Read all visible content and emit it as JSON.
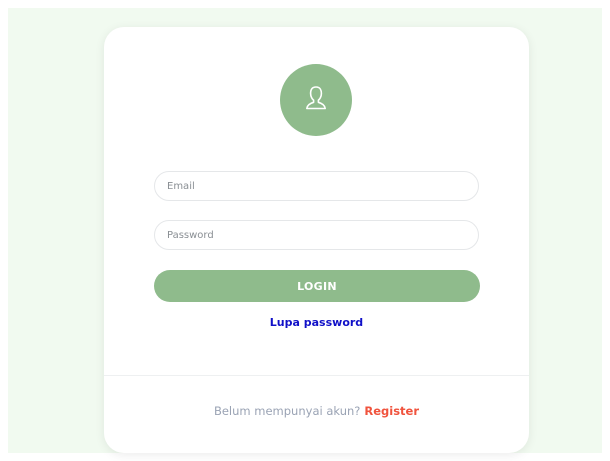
{
  "login_form": {
    "email_placeholder": "Email",
    "password_placeholder": "Password",
    "login_label": "LOGIN",
    "forgot_label": "Lupa password"
  },
  "footer": {
    "question": "Belum mempunyai akun?",
    "register_label": "Register"
  },
  "icons": {
    "avatar": "user-icon"
  },
  "colors": {
    "accent": "#8fbb8c",
    "page_background": "#f1faf0",
    "link": "#1010c8",
    "register": "#f0533d",
    "muted_text": "#9aa3b4"
  }
}
